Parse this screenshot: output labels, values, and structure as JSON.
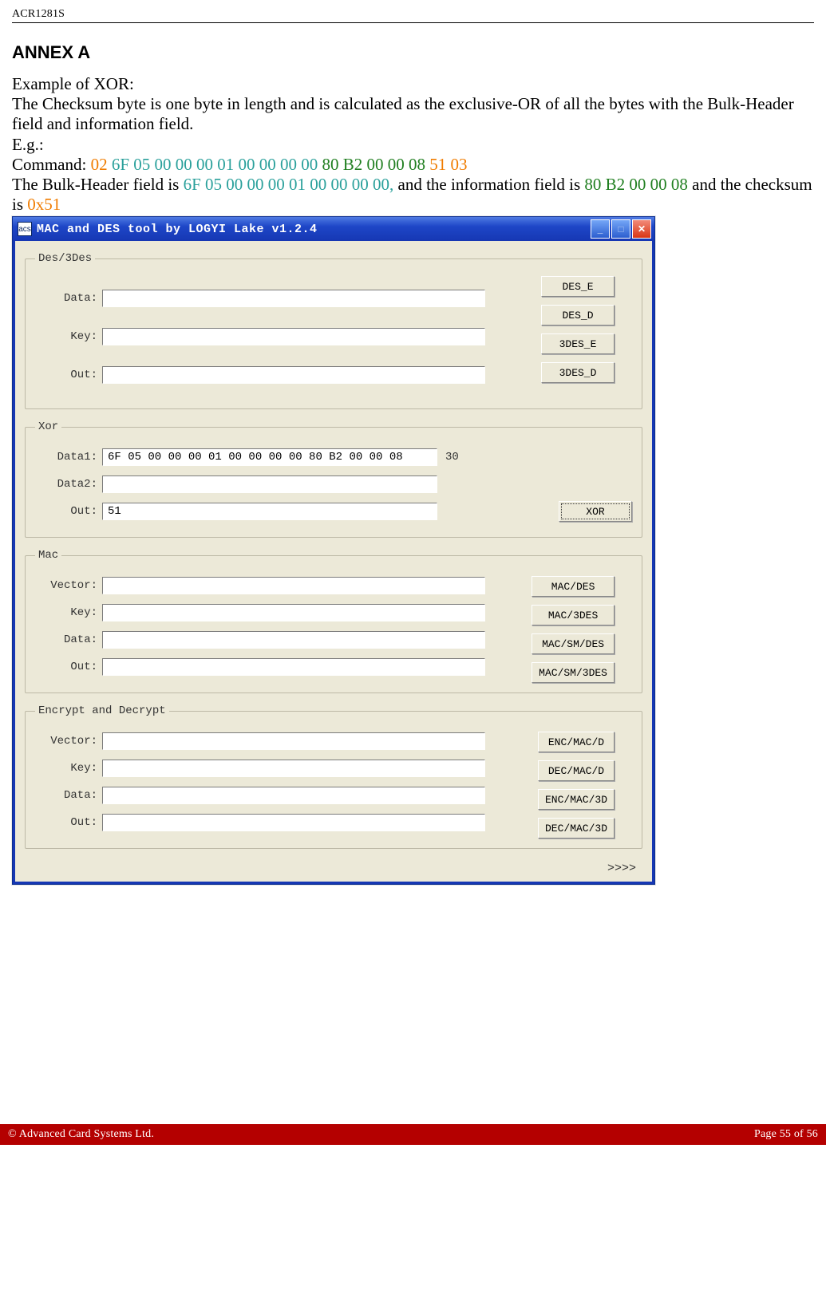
{
  "doc": {
    "header": "ACR1281S",
    "annex_title": "ANNEX A",
    "p1": "Example of XOR:",
    "p2": "The Checksum byte is one byte in length and is calculated as the exclusive-OR of all the bytes with the Bulk-Header field and information field.",
    "p3": "E.g.:",
    "cmd_label": "Command: ",
    "cmd_parts": {
      "a": "02 ",
      "b": "6F 05 00 00 00 01 00 00 00 00 ",
      "c": "80 B2 00 00 08 ",
      "d": "51 03"
    },
    "p5a": "The Bulk-Header field is ",
    "p5b": "6F 05 00 00 00 01 00 00 00 00, ",
    "p5c": "and the information field is ",
    "p5d": "80 B2 00 00 08 ",
    "p5e": "and the checksum is ",
    "p5f": "0x51"
  },
  "window": {
    "title": "MAC and DES tool by LOGYI Lake v1.2.4",
    "more": ">>>>",
    "panels": {
      "des": {
        "legend": "Des/3Des",
        "labels": {
          "data": "Data:",
          "key": "Key:",
          "out": "Out:"
        },
        "values": {
          "data": "",
          "key": "",
          "out": ""
        },
        "buttons": {
          "des_e": "DES_E",
          "des_d": "DES_D",
          "tdes_e": "3DES_E",
          "tdes_d": "3DES_D"
        }
      },
      "xor": {
        "legend": "Xor",
        "labels": {
          "data1": "Data1:",
          "data2": "Data2:",
          "out": "Out:"
        },
        "values": {
          "data1": "6F 05 00 00 00 01 00 00 00 00 80 B2 00 00 08",
          "data2": "",
          "out": "51"
        },
        "count": "30",
        "buttons": {
          "xor": "XOR"
        }
      },
      "mac": {
        "legend": "Mac",
        "labels": {
          "vector": "Vector:",
          "key": "Key:",
          "data": "Data:",
          "out": "Out:"
        },
        "values": {
          "vector": "",
          "key": "",
          "data": "",
          "out": ""
        },
        "buttons": {
          "mac_des": "MAC/DES",
          "mac_3des": "MAC/3DES",
          "mac_sm_des": "MAC/SM/DES",
          "mac_sm_3des": "MAC/SM/3DES"
        }
      },
      "enc": {
        "legend": "Encrypt and Decrypt",
        "labels": {
          "vector": "Vector:",
          "key": "Key:",
          "data": "Data:",
          "out": "Out:"
        },
        "values": {
          "vector": "",
          "key": "",
          "data": "",
          "out": ""
        },
        "buttons": {
          "enc_mac_d": "ENC/MAC/D",
          "dec_mac_d": "DEC/MAC/D",
          "enc_mac_3d": "ENC/MAC/3D",
          "dec_mac_3d": "DEC/MAC/3D"
        }
      }
    }
  },
  "footer": {
    "left": "© Advanced Card Systems Ltd.",
    "right": "Page 55 of 56"
  }
}
